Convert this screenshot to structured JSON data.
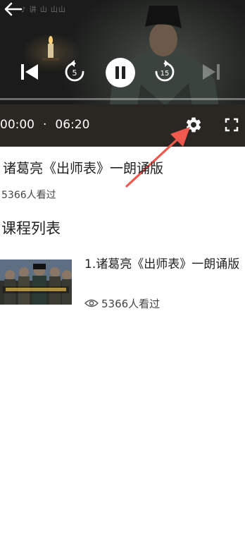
{
  "player": {
    "watermark": "♪ 讲 山 山山",
    "rewind_seconds": "5",
    "forward_seconds": "15",
    "current_time": "00:00",
    "separator": "·",
    "duration": "06:20",
    "progress_fraction": 0,
    "is_playing": true,
    "icons": {
      "back": "arrow-left-icon",
      "prev": "skip-previous-icon",
      "rewind": "rewind-5-icon",
      "play_pause": "pause-icon",
      "forward": "forward-15-icon",
      "next": "skip-next-icon",
      "settings": "gear-icon",
      "fullscreen": "fullscreen-icon"
    }
  },
  "video": {
    "title": "诸葛亮《出师表》一朗诵版",
    "views": "5366人看过"
  },
  "course_list": {
    "heading": "课程列表",
    "items": [
      {
        "name": "1.诸葛亮《出师表》一朗诵版",
        "views": "5366人看过"
      }
    ]
  },
  "colors": {
    "annotation_arrow": "#f05a4e",
    "text": "#222222",
    "player_bg": "#1d1d1c"
  }
}
